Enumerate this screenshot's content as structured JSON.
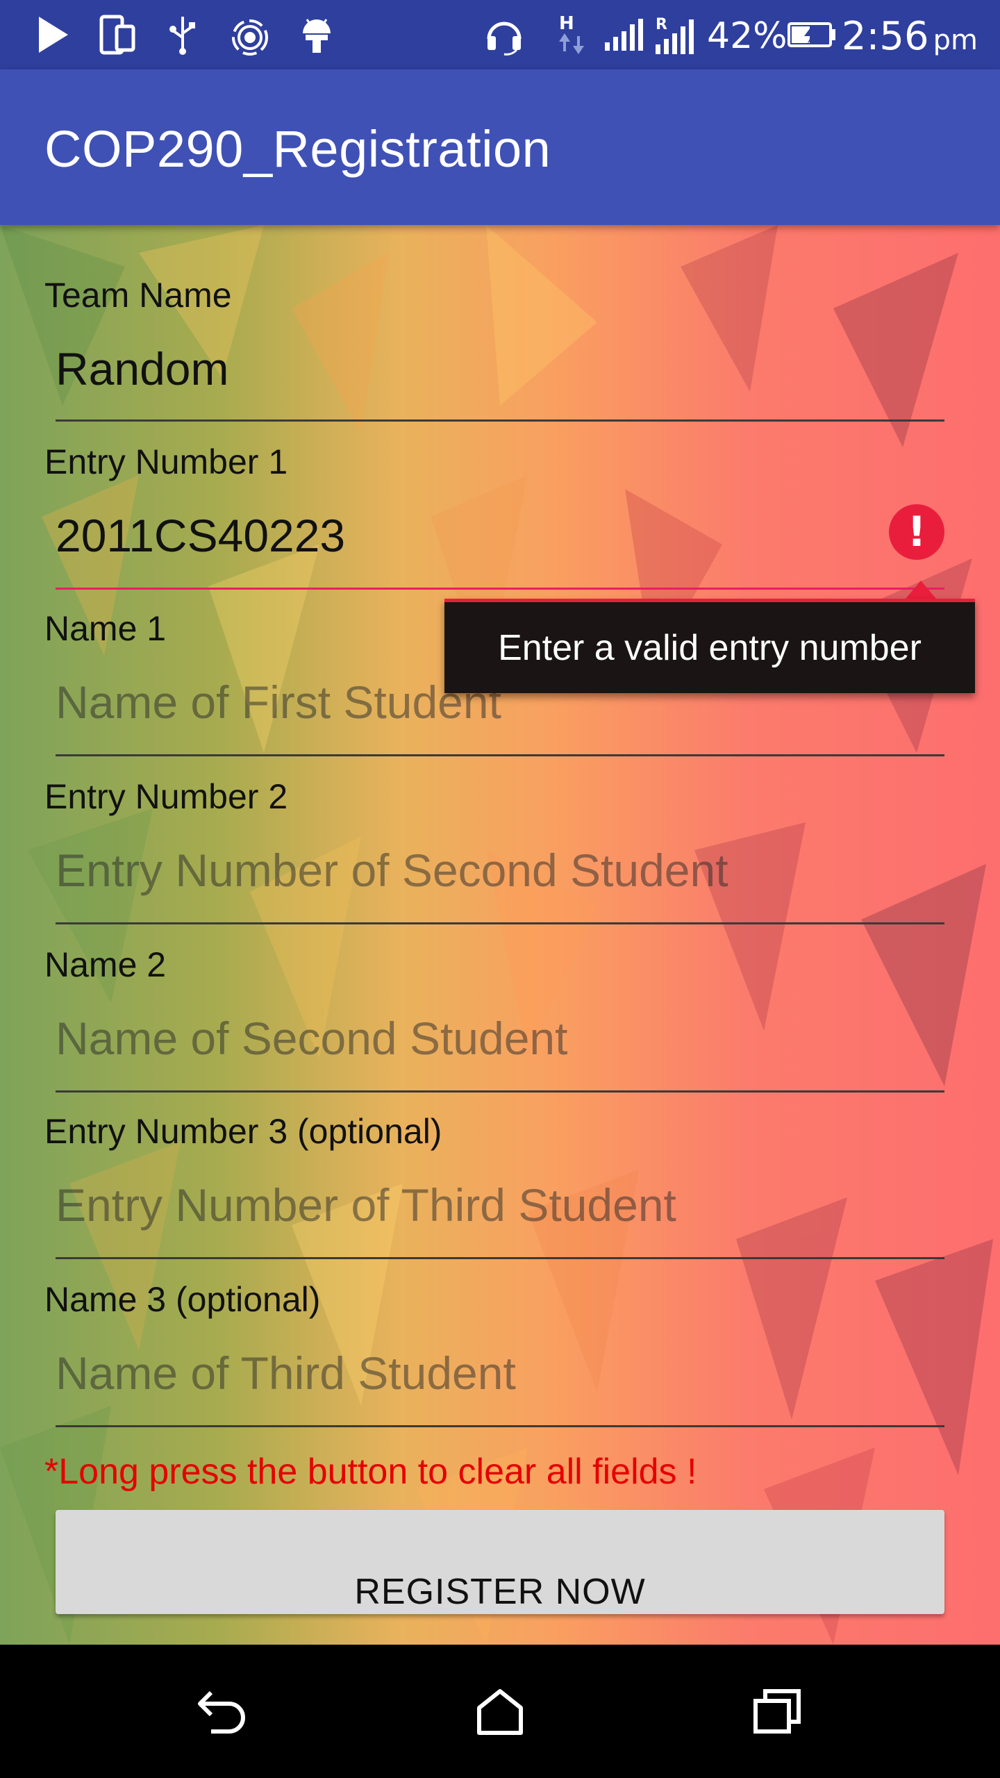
{
  "status_bar": {
    "battery_percent": "42%",
    "time": "2:56",
    "ampm": "pm",
    "icons": [
      "play-icon",
      "device-icon",
      "usb-icon",
      "radio-icon",
      "android-icon",
      "headset-icon",
      "h-data-icon",
      "signal-icon",
      "roaming-signal-icon",
      "battery-charging-icon"
    ]
  },
  "app_bar": {
    "title": "COP290_Registration"
  },
  "form": {
    "team_name": {
      "label": "Team Name",
      "value": "Random",
      "placeholder": ""
    },
    "entry1": {
      "label": "Entry Number 1",
      "value": "2011CS40223",
      "placeholder": "",
      "error": "Enter a valid entry number"
    },
    "name1": {
      "label": "Name 1",
      "value": "",
      "placeholder": "Name of First Student"
    },
    "entry2": {
      "label": "Entry Number 2",
      "value": "",
      "placeholder": "Entry Number of Second Student"
    },
    "name2": {
      "label": "Name 2",
      "value": "",
      "placeholder": "Name of Second Student"
    },
    "entry3": {
      "label": "Entry Number 3 (optional)",
      "value": "",
      "placeholder": "Entry Number of Third Student"
    },
    "name3": {
      "label": "Name 3 (optional)",
      "value": "",
      "placeholder": "Name of Third Student"
    },
    "hint": "*Long press the button to clear all fields !",
    "register_label": "REGISTER NOW"
  },
  "nav_bar": {
    "icons": [
      "back-icon",
      "home-icon",
      "recents-icon"
    ]
  },
  "colors": {
    "status_bar": "#2f3f9e",
    "app_bar": "#3f51b5",
    "error": "#e91e3c",
    "hint": "#e50000",
    "button": "#d9d9d9"
  }
}
